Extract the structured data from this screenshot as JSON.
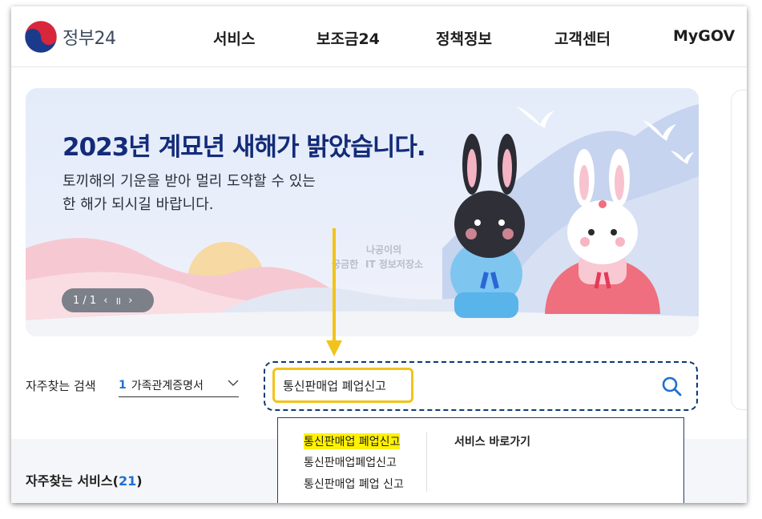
{
  "header": {
    "logo_text": "정부24",
    "nav": [
      "서비스",
      "보조금24",
      "정책정보",
      "고객센터",
      "MyGOV"
    ]
  },
  "banner": {
    "title": "2023년 계묘년 새해가 밝았습니다.",
    "subtitle_line1": "토끼해의 기운을 받아 멀리 도약할 수 있는",
    "subtitle_line2": "한 해가 되시길 바랍니다.",
    "pager": "1 / 1",
    "prev_icon": "‹",
    "pause_icon": "॥",
    "next_icon": "›"
  },
  "watermark": {
    "line1": "나공이의",
    "line2a": "궁금한",
    "line2b": "IT 정보저장소"
  },
  "frequent_search": {
    "label": "자주찾는 검색",
    "rank": "1",
    "value": "가족관계증명서"
  },
  "search": {
    "value": "통신판매업 폐업신고"
  },
  "autocomplete": {
    "suggestions": [
      "통신판매업 폐업신고",
      "통신판매업폐업신고",
      "통신판매업 폐업 신고"
    ],
    "shortcut_label": "서비스 바로가기"
  },
  "frequent_services": {
    "label": "자주찾는 서비스",
    "count": "21"
  },
  "colors": {
    "highlight": "#fff200",
    "accent_blue": "#1f6fd1",
    "arrow": "#f2c31b"
  }
}
